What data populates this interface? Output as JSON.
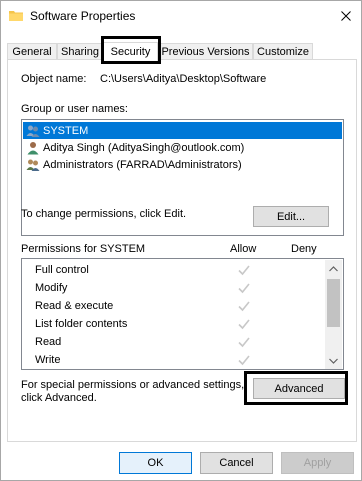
{
  "window": {
    "title": "Software Properties"
  },
  "tabs": [
    {
      "label": "General"
    },
    {
      "label": "Sharing"
    },
    {
      "label": "Security",
      "active": true
    },
    {
      "label": "Previous Versions"
    },
    {
      "label": "Customize"
    }
  ],
  "security": {
    "object_name_label": "Object name:",
    "object_name_value": "C:\\Users\\Aditya\\Desktop\\Software",
    "groups_label": "Group or user names:",
    "users": [
      {
        "name": "SYSTEM",
        "icon": "group-users-icon",
        "selected": true
      },
      {
        "name": "Aditya Singh (AdityaSingh@outlook.com)",
        "icon": "user-icon"
      },
      {
        "name": "Administrators (FARRAD\\Administrators)",
        "icon": "group-users-icon"
      }
    ],
    "change_hint": "To change permissions, click Edit.",
    "edit_button": "Edit...",
    "permissions_label": "Permissions for SYSTEM",
    "allow_header": "Allow",
    "deny_header": "Deny",
    "permissions": [
      {
        "name": "Full control",
        "allow": true,
        "deny": false
      },
      {
        "name": "Modify",
        "allow": true,
        "deny": false
      },
      {
        "name": "Read & execute",
        "allow": true,
        "deny": false
      },
      {
        "name": "List folder contents",
        "allow": true,
        "deny": false
      },
      {
        "name": "Read",
        "allow": true,
        "deny": false
      },
      {
        "name": "Write",
        "allow": true,
        "deny": false
      }
    ],
    "advanced_hint_line1": "For special permissions or advanced settings,",
    "advanced_hint_line2": "click Advanced.",
    "advanced_button": "Advanced"
  },
  "footer": {
    "ok": "OK",
    "cancel": "Cancel",
    "apply": "Apply"
  },
  "colors": {
    "selection": "#0078d7",
    "check": "#c8c8c8",
    "highlight_outline": "#000000"
  }
}
